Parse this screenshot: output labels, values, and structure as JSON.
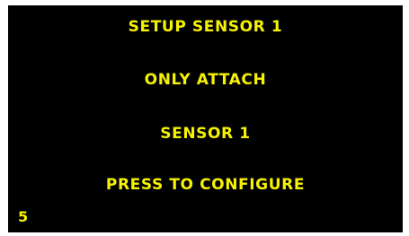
{
  "screen": {
    "title": "SETUP SENSOR 1",
    "instruction_line1": "ONLY ATTACH",
    "instruction_line2": "SENSOR 1",
    "action": "PRESS TO CONFIGURE",
    "countdown": "5"
  },
  "colors": {
    "background": "#000000",
    "text": "#f6f200"
  }
}
